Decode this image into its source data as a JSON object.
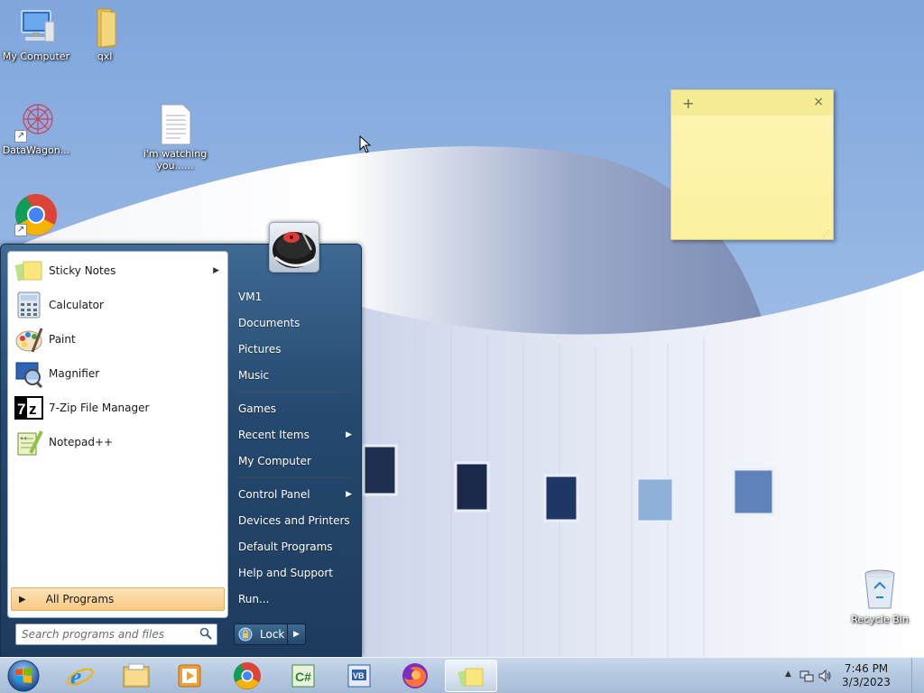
{
  "desktop": {
    "icons": [
      {
        "label": "My Computer"
      },
      {
        "label": "qxl"
      },
      {
        "label": "DataWagon..."
      },
      {
        "label": "i'm watching you......"
      },
      {
        "label": ""
      },
      {
        "label": "Recycle Bin"
      }
    ]
  },
  "sticky_note": {
    "add_glyph": "+",
    "close_glyph": "×"
  },
  "start_menu": {
    "programs": [
      {
        "label": "Sticky Notes",
        "icon": "sticky-notes-icon",
        "has_submenu": true
      },
      {
        "label": "Calculator",
        "icon": "calculator-icon"
      },
      {
        "label": "Paint",
        "icon": "paint-icon"
      },
      {
        "label": "Magnifier",
        "icon": "magnifier-icon"
      },
      {
        "label": "7-Zip File Manager",
        "icon": "7zip-icon"
      },
      {
        "label": "Notepad++",
        "icon": "notepadpp-icon"
      }
    ],
    "all_programs": "All Programs",
    "search_placeholder": "Search programs and files",
    "places": [
      {
        "label": "VM1"
      },
      {
        "label": "Documents"
      },
      {
        "label": "Pictures"
      },
      {
        "label": "Music"
      },
      {
        "label": "Games"
      },
      {
        "label": "Recent Items",
        "has_submenu": true
      },
      {
        "label": "My Computer"
      },
      {
        "label": "Control Panel",
        "has_submenu": true
      },
      {
        "label": "Devices and Printers"
      },
      {
        "label": "Default Programs"
      },
      {
        "label": "Help and Support"
      },
      {
        "label": "Run..."
      }
    ],
    "lock_label": "Lock"
  },
  "taskbar": {
    "pinned": [
      {
        "icon": "internet-explorer-icon"
      },
      {
        "icon": "file-explorer-icon"
      },
      {
        "icon": "media-player-icon"
      },
      {
        "icon": "chrome-icon"
      },
      {
        "icon": "csharp-icon"
      },
      {
        "icon": "vb-icon"
      },
      {
        "icon": "firefox-icon"
      },
      {
        "icon": "sticky-notes-icon",
        "active": true
      }
    ],
    "clock": {
      "time": "7:46 PM",
      "date": "3/3/2023"
    }
  },
  "colors": {
    "start_menu_bg": "#26496f",
    "all_programs_highlight": "#f7c982",
    "sticky_note": "#fbf1a0",
    "taskbar": "#b4c8e0"
  }
}
